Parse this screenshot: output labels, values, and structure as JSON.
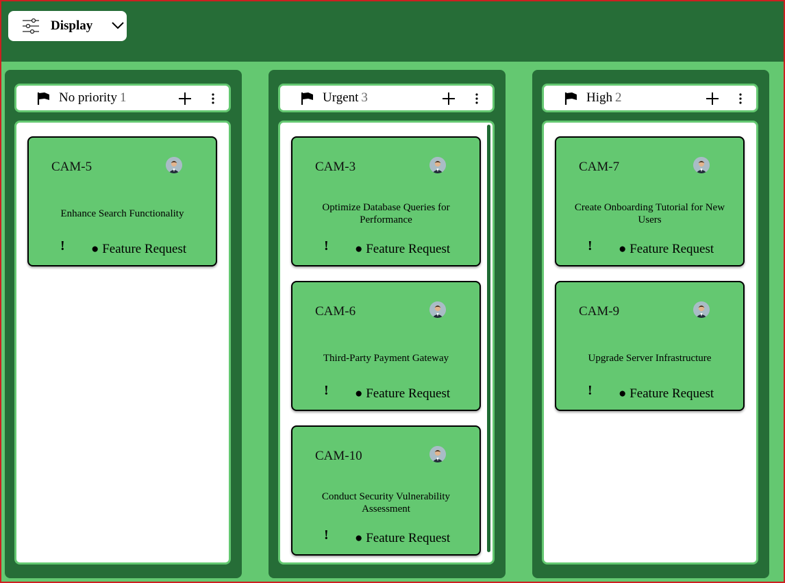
{
  "toolbar": {
    "display_label": "Display",
    "display_icon": "sliders-icon",
    "chevron_icon": "chevron-down-icon"
  },
  "columns": [
    {
      "title": "No priority",
      "count": "1",
      "cards": [
        {
          "id": "CAM-5",
          "title": "Enhance Search Functionality",
          "priority": "!",
          "tag": "● Feature Request"
        }
      ]
    },
    {
      "title": "Urgent",
      "count": "3",
      "cards": [
        {
          "id": "CAM-3",
          "title": "Optimize Database Queries for Performance",
          "priority": "!",
          "tag": "● Feature Request"
        },
        {
          "id": "CAM-6",
          "title": "Third-Party Payment Gateway",
          "priority": "!",
          "tag": "● Feature Request"
        },
        {
          "id": "CAM-10",
          "title": "Conduct Security Vulnerability Assessment",
          "priority": "!",
          "tag": "● Feature Request"
        }
      ]
    },
    {
      "title": "High",
      "count": "2",
      "cards": [
        {
          "id": "CAM-7",
          "title": "Create Onboarding Tutorial for New Users",
          "priority": "!",
          "tag": "● Feature Request"
        },
        {
          "id": "CAM-9",
          "title": "Upgrade Server Infrastructure",
          "priority": "!",
          "tag": "● Feature Request"
        }
      ]
    }
  ],
  "colors": {
    "topbar": "#266d37",
    "background": "#64c871",
    "card": "#64c871",
    "column": "#266d37"
  }
}
